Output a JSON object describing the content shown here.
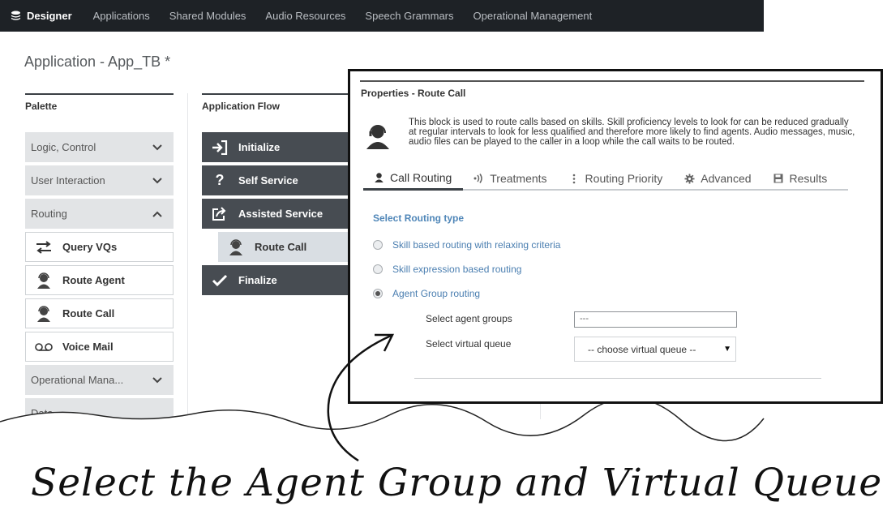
{
  "nav": {
    "brand": "Designer",
    "items": [
      "Applications",
      "Shared Modules",
      "Audio Resources",
      "Speech Grammars",
      "Operational Management"
    ]
  },
  "app_title": "Application - App_TB *",
  "palette": {
    "title": "Palette",
    "categories": {
      "logic": "Logic, Control",
      "user_interaction": "User Interaction",
      "routing": "Routing",
      "operational": "Operational Mana...",
      "data": "Data"
    },
    "blocks": {
      "query_vqs": "Query VQs",
      "route_agent": "Route Agent",
      "route_call": "Route Call",
      "voice_mail": "Voice Mail"
    }
  },
  "flow": {
    "title": "Application Flow",
    "blocks": {
      "initialize": "Initialize",
      "self_service": "Self Service",
      "assisted_service": "Assisted Service",
      "route_call": "Route Call",
      "finalize": "Finalize"
    }
  },
  "properties": {
    "header": "Properties - Route Call",
    "description": "This block is used to route calls based on skills. Skill proficiency levels to look for can be reduced gradually at regular intervals to look for less qualified and therefore more likely to find agents. Audio messages, music, audio files can be played to the caller in a loop while the call waits to be routed.",
    "tabs": [
      "Call Routing",
      "Treatments",
      "Routing Priority",
      "Advanced",
      "Results"
    ],
    "routing_type_label": "Select Routing type",
    "options": {
      "skill_relaxing": "Skill based routing with relaxing criteria",
      "skill_expression": "Skill expression based routing",
      "agent_group": "Agent Group routing"
    },
    "agent_groups_label": "Select agent groups",
    "agent_groups_value": "---",
    "virtual_queue_label": "Select virtual queue",
    "virtual_queue_value": "-- choose virtual queue --"
  },
  "caption": "Select the Agent Group and Virtual Queue",
  "colors": {
    "nav_bg": "#1e2226",
    "flow_block": "#474c52",
    "link_blue": "#4a7eb0",
    "palette_category": "#e2e4e6"
  }
}
